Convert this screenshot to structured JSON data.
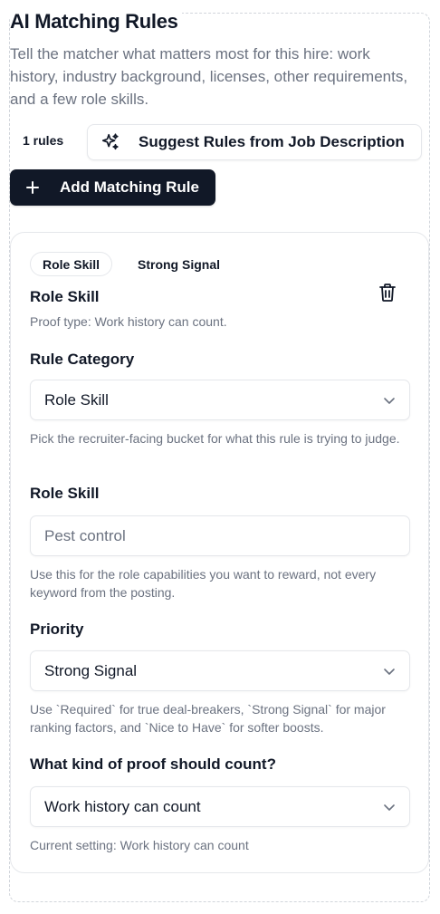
{
  "header": {
    "title": "AI Matching Rules",
    "description": "Tell the matcher what matters most for this hire: work history, industry background, licenses, other requirements, and a few role skills."
  },
  "toolbar": {
    "rule_count": "1 rules",
    "suggest_label": "Suggest Rules from Job Description",
    "add_label": "Add Matching Rule"
  },
  "rule": {
    "badge_category": "Role Skill",
    "badge_priority": "Strong Signal",
    "heading": "Role Skill",
    "proof_line": "Proof type: Work history can count.",
    "category": {
      "label": "Rule Category",
      "value": "Role Skill",
      "help": "Pick the recruiter-facing bucket for what this rule is trying to judge."
    },
    "skill": {
      "label": "Role Skill",
      "placeholder": "Pest control",
      "help": "Use this for the role capabilities you want to reward, not every keyword from the posting."
    },
    "priority": {
      "label": "Priority",
      "value": "Strong Signal",
      "help": "Use `Required` for true deal-breakers, `Strong Signal` for major ranking factors, and `Nice to Have` for softer boosts."
    },
    "proof": {
      "label": "What kind of proof should count?",
      "value": "Work history can count",
      "help": "Current setting: Work history can count"
    }
  },
  "icons": {
    "suggest": "sparkles-icon",
    "add": "plus-icon",
    "delete": "trash-icon",
    "dropdown": "chevron-down-icon"
  },
  "colors": {
    "primary_button": "#111827",
    "muted_text": "#6b7280",
    "border": "#e5e7eb"
  }
}
